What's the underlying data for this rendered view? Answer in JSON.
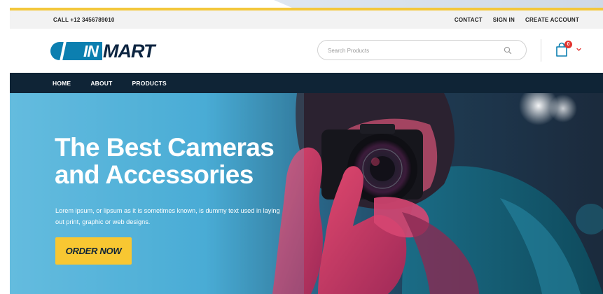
{
  "topbar": {
    "call_text": "CALL +12 3456789010",
    "links": [
      "CONTACT",
      "SIGN IN",
      "CREATE ACCOUNT"
    ]
  },
  "header": {
    "logo": {
      "left_text": "IN",
      "right_text": "MART"
    },
    "search": {
      "placeholder": "Search Products",
      "value": ""
    },
    "cart": {
      "count": "0"
    }
  },
  "nav": {
    "items": [
      "HOME",
      "ABOUT",
      "PRODUCTS"
    ]
  },
  "hero": {
    "title_line1": "The Best Cameras",
    "title_line2": "and Accessories",
    "text": "Lorem ipsum, or lipsum as it is sometimes known, is dummy text used in laying out print, graphic or web designs.",
    "button": "ORDER NOW"
  },
  "colors": {
    "accent_yellow": "#f8c732",
    "nav_dark": "#0f2436",
    "logo_blue": "#0c7fb0",
    "logo_navy": "#0c2440",
    "badge_red": "#e3342f"
  },
  "icons": [
    "search-icon",
    "cart-icon",
    "chevron-down-icon"
  ]
}
